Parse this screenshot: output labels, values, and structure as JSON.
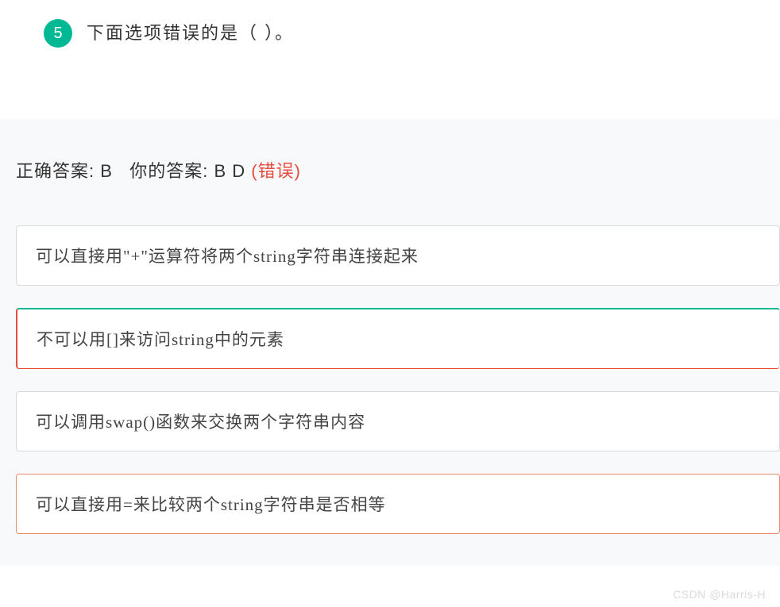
{
  "question": {
    "number": "5",
    "text": "下面选项错误的是（  ）。"
  },
  "answer": {
    "correct_label": "正确答案: ",
    "correct_value": "B",
    "your_label": "你的答案: ",
    "your_value": "B D ",
    "status": "(错误)"
  },
  "options": [
    {
      "text": "可以直接用\"+\"运算符将两个string字符串连接起来",
      "state": "neutral"
    },
    {
      "text": "不可以用[]来访问string中的元素",
      "state": "correct"
    },
    {
      "text": "可以调用swap()函数来交换两个字符串内容",
      "state": "neutral"
    },
    {
      "text": "可以直接用=来比较两个string字符串是否相等",
      "state": "wrong"
    }
  ],
  "watermark": "CSDN @Harris-H"
}
